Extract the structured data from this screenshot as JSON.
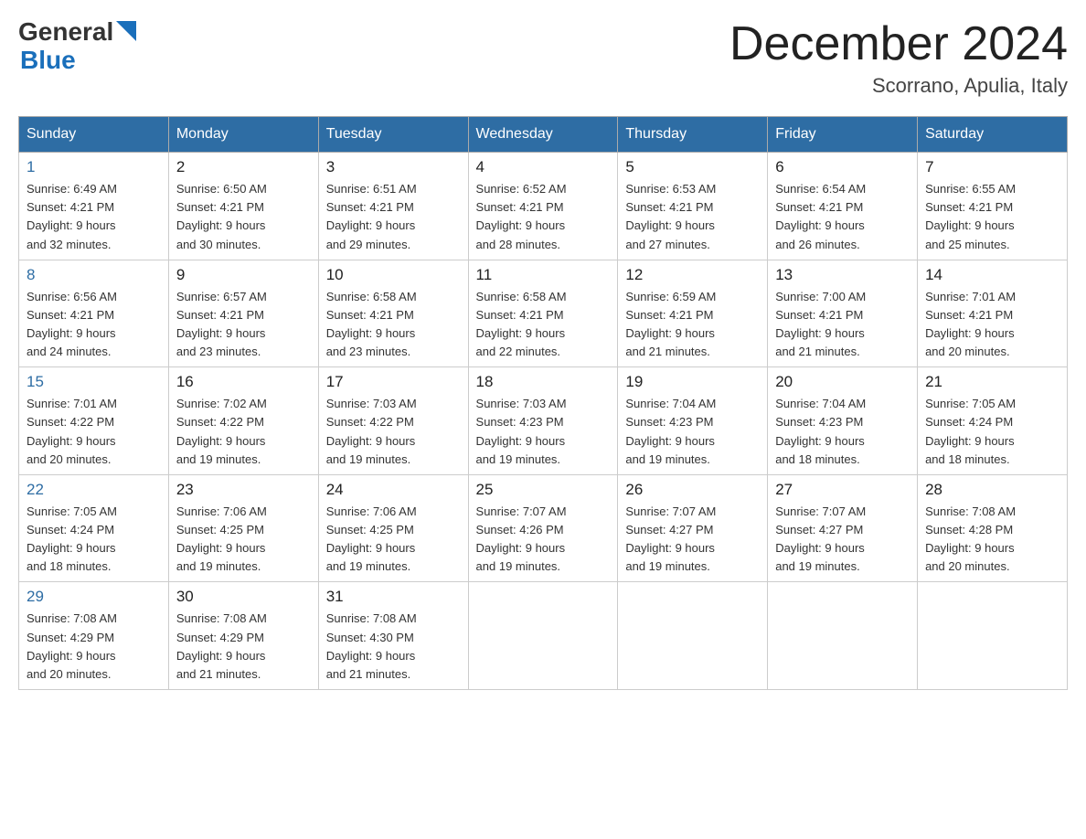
{
  "logo": {
    "text_general": "General",
    "text_blue": "Blue"
  },
  "header": {
    "month_title": "December 2024",
    "location": "Scorrano, Apulia, Italy"
  },
  "weekdays": [
    "Sunday",
    "Monday",
    "Tuesday",
    "Wednesday",
    "Thursday",
    "Friday",
    "Saturday"
  ],
  "weeks": [
    [
      {
        "day": "1",
        "sunrise": "6:49 AM",
        "sunset": "4:21 PM",
        "daylight": "9 hours and 32 minutes."
      },
      {
        "day": "2",
        "sunrise": "6:50 AM",
        "sunset": "4:21 PM",
        "daylight": "9 hours and 30 minutes."
      },
      {
        "day": "3",
        "sunrise": "6:51 AM",
        "sunset": "4:21 PM",
        "daylight": "9 hours and 29 minutes."
      },
      {
        "day": "4",
        "sunrise": "6:52 AM",
        "sunset": "4:21 PM",
        "daylight": "9 hours and 28 minutes."
      },
      {
        "day": "5",
        "sunrise": "6:53 AM",
        "sunset": "4:21 PM",
        "daylight": "9 hours and 27 minutes."
      },
      {
        "day": "6",
        "sunrise": "6:54 AM",
        "sunset": "4:21 PM",
        "daylight": "9 hours and 26 minutes."
      },
      {
        "day": "7",
        "sunrise": "6:55 AM",
        "sunset": "4:21 PM",
        "daylight": "9 hours and 25 minutes."
      }
    ],
    [
      {
        "day": "8",
        "sunrise": "6:56 AM",
        "sunset": "4:21 PM",
        "daylight": "9 hours and 24 minutes."
      },
      {
        "day": "9",
        "sunrise": "6:57 AM",
        "sunset": "4:21 PM",
        "daylight": "9 hours and 23 minutes."
      },
      {
        "day": "10",
        "sunrise": "6:58 AM",
        "sunset": "4:21 PM",
        "daylight": "9 hours and 23 minutes."
      },
      {
        "day": "11",
        "sunrise": "6:58 AM",
        "sunset": "4:21 PM",
        "daylight": "9 hours and 22 minutes."
      },
      {
        "day": "12",
        "sunrise": "6:59 AM",
        "sunset": "4:21 PM",
        "daylight": "9 hours and 21 minutes."
      },
      {
        "day": "13",
        "sunrise": "7:00 AM",
        "sunset": "4:21 PM",
        "daylight": "9 hours and 21 minutes."
      },
      {
        "day": "14",
        "sunrise": "7:01 AM",
        "sunset": "4:21 PM",
        "daylight": "9 hours and 20 minutes."
      }
    ],
    [
      {
        "day": "15",
        "sunrise": "7:01 AM",
        "sunset": "4:22 PM",
        "daylight": "9 hours and 20 minutes."
      },
      {
        "day": "16",
        "sunrise": "7:02 AM",
        "sunset": "4:22 PM",
        "daylight": "9 hours and 19 minutes."
      },
      {
        "day": "17",
        "sunrise": "7:03 AM",
        "sunset": "4:22 PM",
        "daylight": "9 hours and 19 minutes."
      },
      {
        "day": "18",
        "sunrise": "7:03 AM",
        "sunset": "4:23 PM",
        "daylight": "9 hours and 19 minutes."
      },
      {
        "day": "19",
        "sunrise": "7:04 AM",
        "sunset": "4:23 PM",
        "daylight": "9 hours and 19 minutes."
      },
      {
        "day": "20",
        "sunrise": "7:04 AM",
        "sunset": "4:23 PM",
        "daylight": "9 hours and 18 minutes."
      },
      {
        "day": "21",
        "sunrise": "7:05 AM",
        "sunset": "4:24 PM",
        "daylight": "9 hours and 18 minutes."
      }
    ],
    [
      {
        "day": "22",
        "sunrise": "7:05 AM",
        "sunset": "4:24 PM",
        "daylight": "9 hours and 18 minutes."
      },
      {
        "day": "23",
        "sunrise": "7:06 AM",
        "sunset": "4:25 PM",
        "daylight": "9 hours and 19 minutes."
      },
      {
        "day": "24",
        "sunrise": "7:06 AM",
        "sunset": "4:25 PM",
        "daylight": "9 hours and 19 minutes."
      },
      {
        "day": "25",
        "sunrise": "7:07 AM",
        "sunset": "4:26 PM",
        "daylight": "9 hours and 19 minutes."
      },
      {
        "day": "26",
        "sunrise": "7:07 AM",
        "sunset": "4:27 PM",
        "daylight": "9 hours and 19 minutes."
      },
      {
        "day": "27",
        "sunrise": "7:07 AM",
        "sunset": "4:27 PM",
        "daylight": "9 hours and 19 minutes."
      },
      {
        "day": "28",
        "sunrise": "7:08 AM",
        "sunset": "4:28 PM",
        "daylight": "9 hours and 20 minutes."
      }
    ],
    [
      {
        "day": "29",
        "sunrise": "7:08 AM",
        "sunset": "4:29 PM",
        "daylight": "9 hours and 20 minutes."
      },
      {
        "day": "30",
        "sunrise": "7:08 AM",
        "sunset": "4:29 PM",
        "daylight": "9 hours and 21 minutes."
      },
      {
        "day": "31",
        "sunrise": "7:08 AM",
        "sunset": "4:30 PM",
        "daylight": "9 hours and 21 minutes."
      },
      null,
      null,
      null,
      null
    ]
  ]
}
